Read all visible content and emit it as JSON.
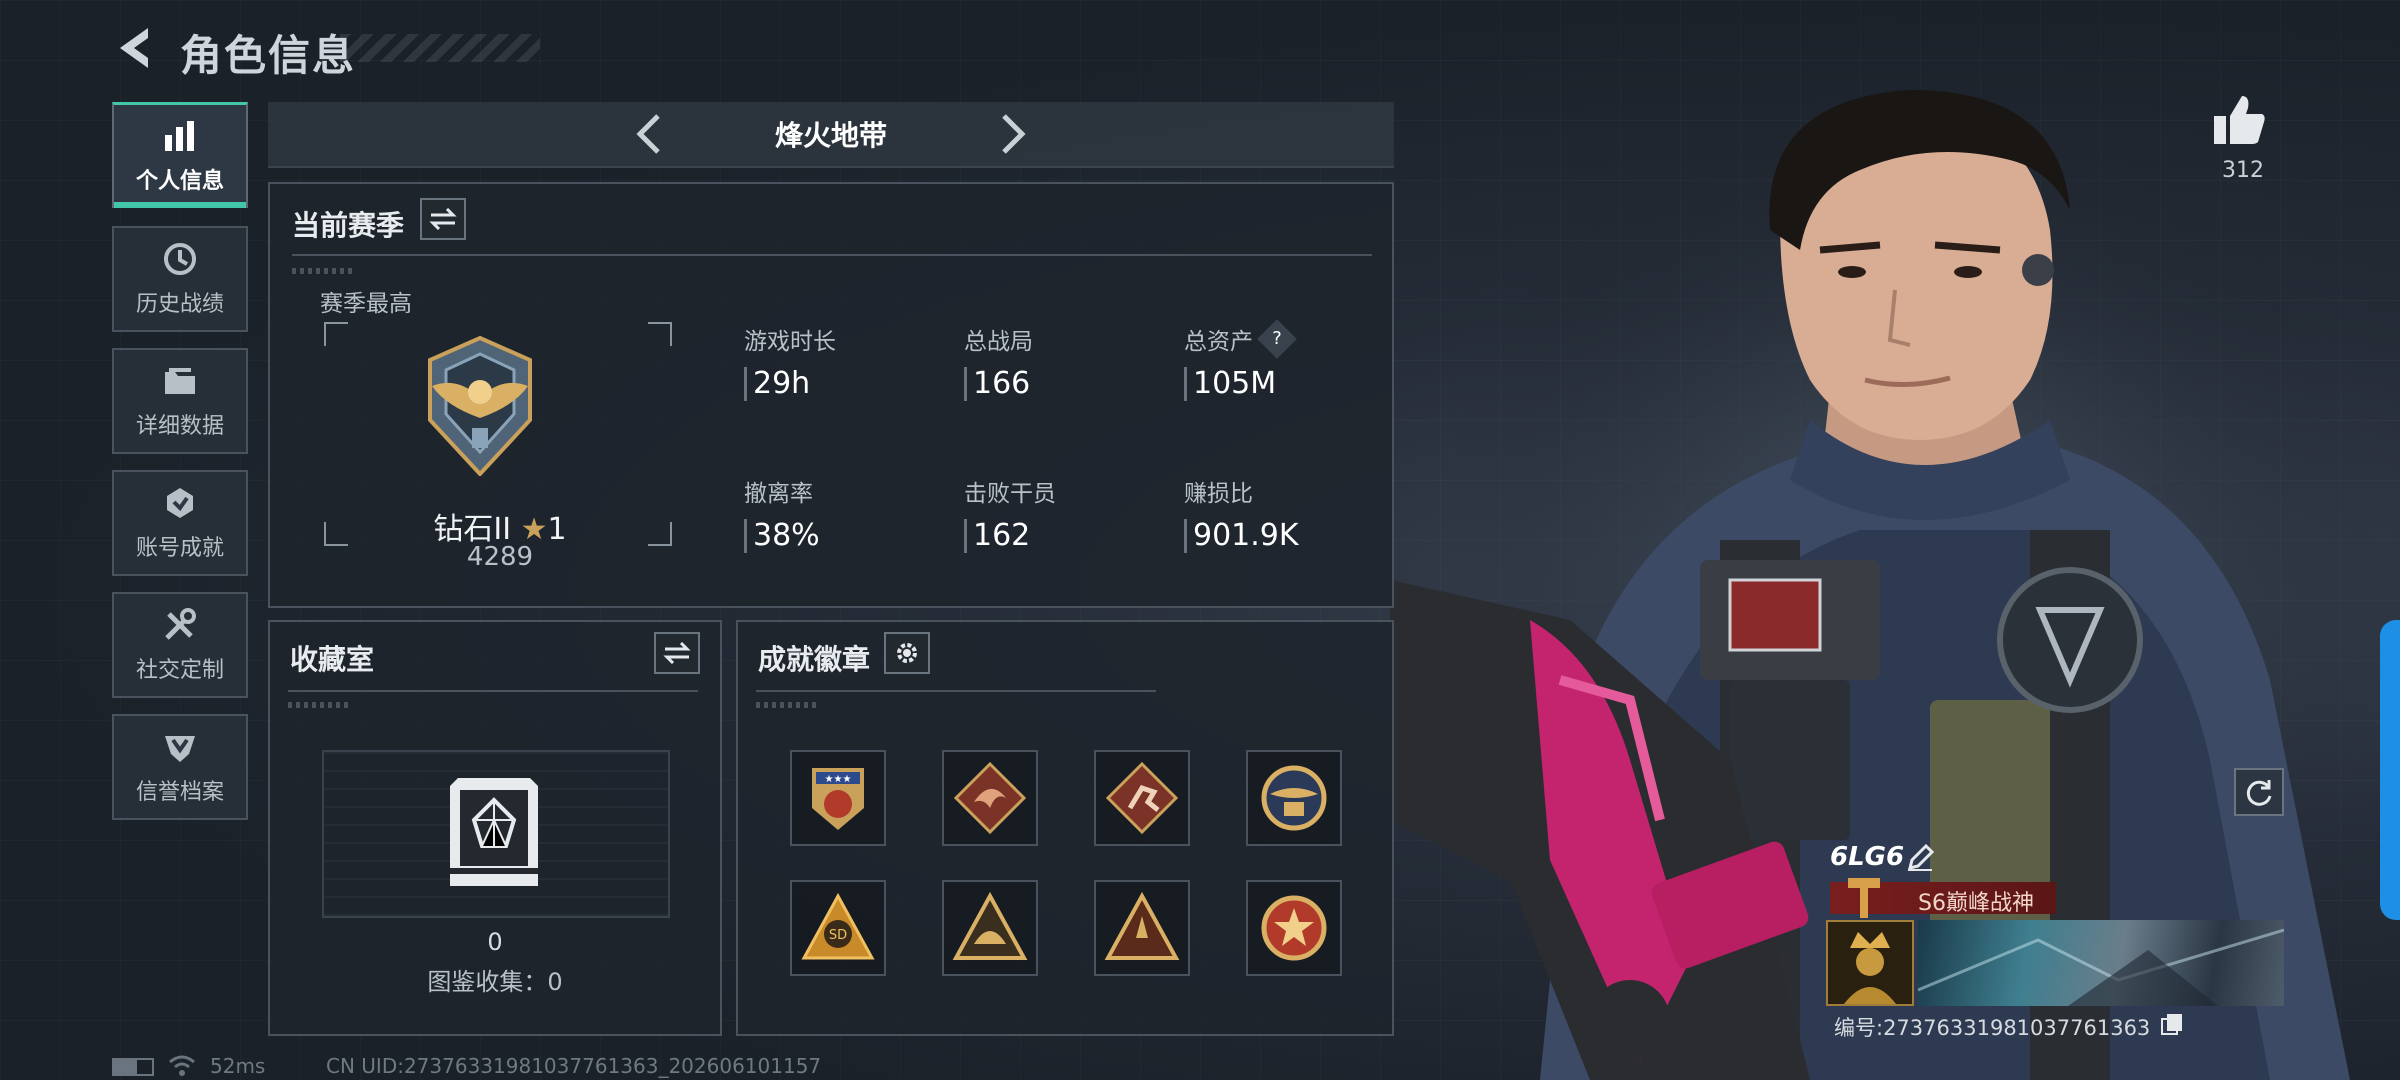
{
  "header": {
    "title": "角色信息"
  },
  "sidebar": {
    "items": [
      {
        "label": "个人信息",
        "icon": "bar-chart-icon",
        "active": true
      },
      {
        "label": "历史战绩",
        "icon": "history-clock-icon"
      },
      {
        "label": "详细数据",
        "icon": "folder-icon"
      },
      {
        "label": "账号成就",
        "icon": "achievement-icon"
      },
      {
        "label": "社交定制",
        "icon": "tools-icon"
      },
      {
        "label": "信誉档案",
        "icon": "shield-icon"
      }
    ]
  },
  "mode": {
    "label": "烽火地带"
  },
  "season": {
    "title": "当前赛季",
    "best_label": "赛季最高",
    "rank_name": "钻石II",
    "rank_stars": "1",
    "rank_points": "4289",
    "stats": [
      {
        "label": "游戏时长",
        "value": "29h"
      },
      {
        "label": "总战局",
        "value": "166"
      },
      {
        "label": "总资产",
        "value": "105M",
        "has_help": true
      },
      {
        "label": "撤离率",
        "value": "38%"
      },
      {
        "label": "击败干员",
        "value": "162"
      },
      {
        "label": "赚损比",
        "value": "901.9K"
      }
    ]
  },
  "collection": {
    "title": "收藏室",
    "count": "0",
    "codex_label": "图鉴收集：0"
  },
  "badges": {
    "title": "成就徽章",
    "items": [
      "badge-star-emblem-icon",
      "badge-dragon-icon",
      "badge-runner-icon",
      "badge-wings-emblem-icon",
      "badge-sd-triangle-icon",
      "badge-helmet-triangle-icon",
      "badge-star-triangle-icon",
      "badge-star-round-icon"
    ]
  },
  "player": {
    "name": "6LG6",
    "title_tag": "S6巅峰战神",
    "id_line": "编号:2737633198103776136​3",
    "likes": "312"
  },
  "footer": {
    "ping": "52ms",
    "uid": "CN UID:2737633198103776136​3_202606101157"
  },
  "colors": {
    "accent": "#44c6a8",
    "title_tag_bg": "#7a1f1f",
    "edge_tab": "#1d8fe6"
  }
}
